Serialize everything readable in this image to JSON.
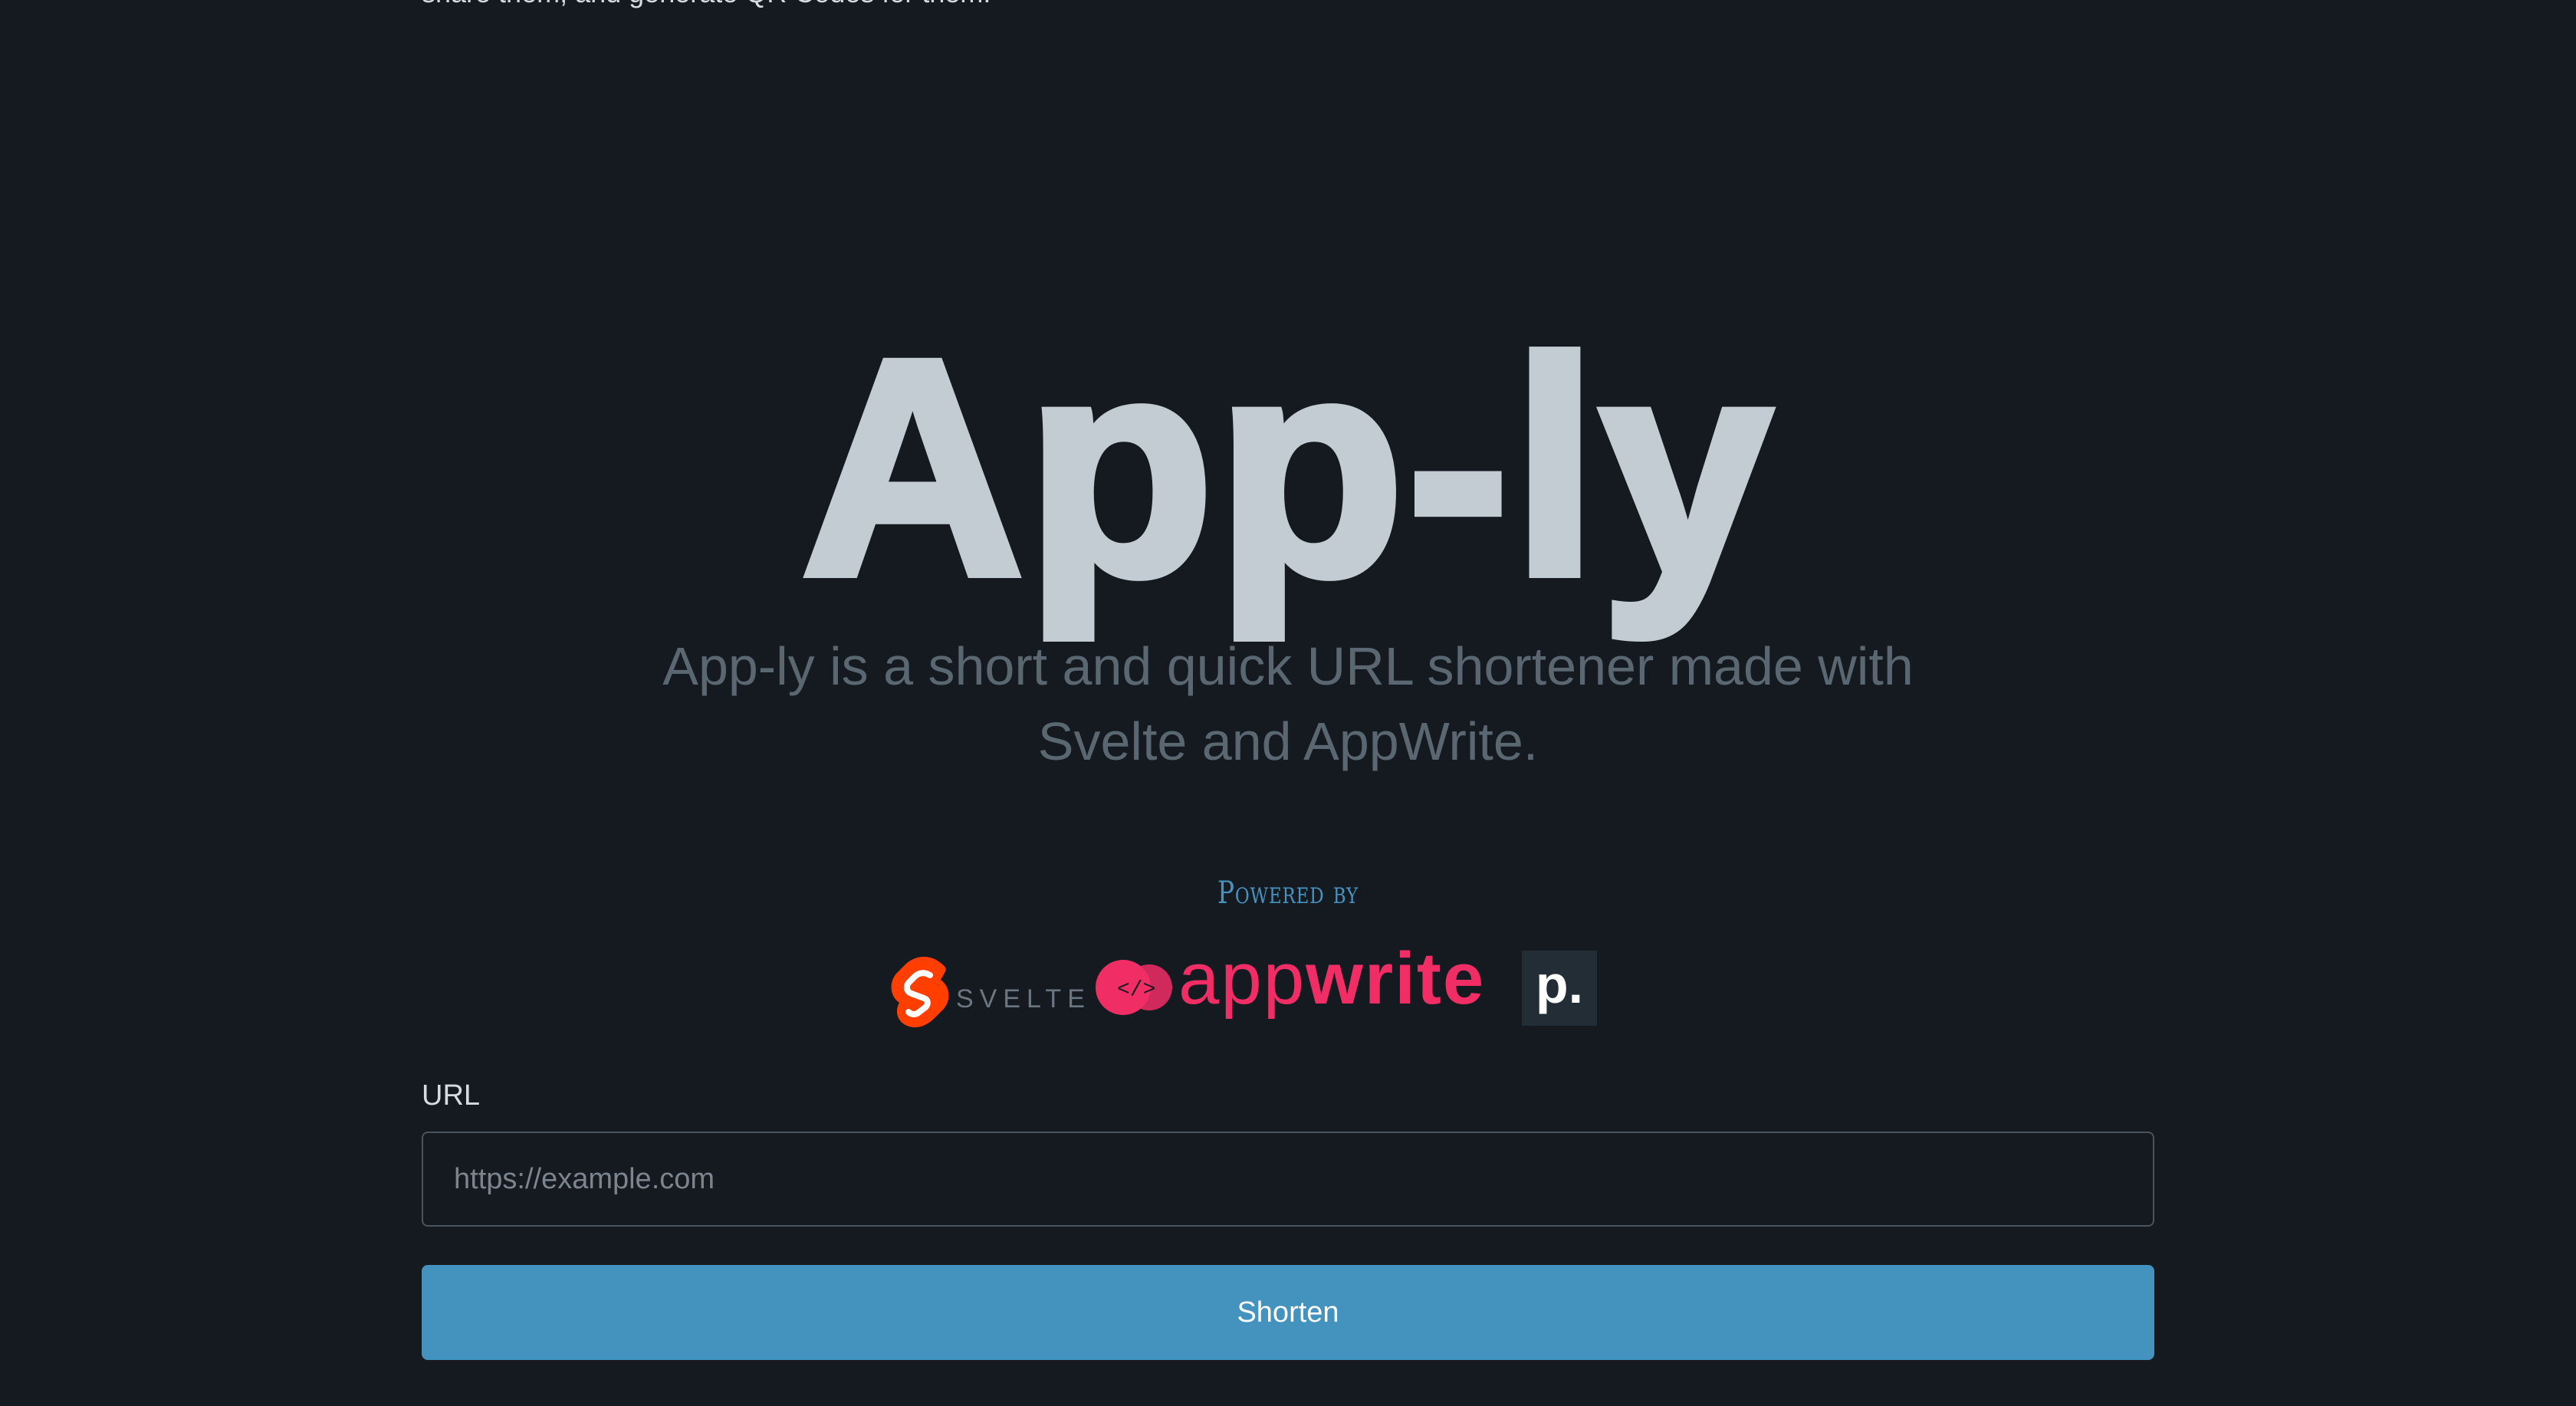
{
  "intro": {
    "text": "share them, and generate QR Codes for them."
  },
  "hero": {
    "title": "App-ly",
    "subtitle": "App-ly is a short and quick URL shortener made with Svelte and AppWrite."
  },
  "powered_by": {
    "label": "Powered by",
    "logos": [
      {
        "name": "svelte",
        "text": "SVELTE",
        "color": "#ff3e00"
      },
      {
        "name": "appwrite",
        "text_light": "app",
        "text_bold": "write",
        "color": "#f02e65"
      },
      {
        "name": "p",
        "text": "p."
      }
    ]
  },
  "form": {
    "url_label": "URL",
    "url_placeholder": "https://example.com",
    "url_value": "",
    "submit_label": "Shorten"
  },
  "colors": {
    "background": "#151a21",
    "accent": "#4393be",
    "title": "#c3ccd3",
    "subtitle": "#5b6770"
  }
}
